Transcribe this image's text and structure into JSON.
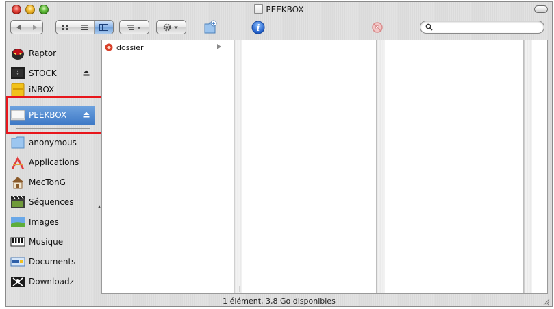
{
  "window": {
    "title": "PEEKBOX"
  },
  "toolbar": {
    "back_icon": "back-arrow-icon",
    "forward_icon": "forward-arrow-icon",
    "view_icons": [
      "icon-view-icon",
      "list-view-icon",
      "column-view-icon"
    ],
    "arrange_icon": "arrange-icon",
    "action_icon": "gear-icon",
    "new_folder_icon": "new-folder-icon",
    "info_icon": "info-icon",
    "burn_icon": "burn-icon",
    "search": {
      "value": "",
      "placeholder": ""
    }
  },
  "sidebar": {
    "items": [
      {
        "label": "Raptor",
        "icon": "raptor-disk-icon",
        "eject": false
      },
      {
        "label": "STOCK",
        "icon": "stock-drive-icon",
        "eject": true
      },
      {
        "label": "iNBOX",
        "icon": "inbox-drive-icon",
        "eject": false
      },
      {
        "label": "PEEKBOX",
        "icon": "peekbox-drive-icon",
        "eject": true,
        "selected": true
      },
      {
        "label": "anonymous",
        "icon": "folder-icon",
        "eject": false
      },
      {
        "label": "Applications",
        "icon": "applications-icon",
        "eject": false
      },
      {
        "label": "MecTonG",
        "icon": "home-icon",
        "eject": false
      },
      {
        "label": "Séquences",
        "icon": "movies-icon",
        "eject": false
      },
      {
        "label": "Images",
        "icon": "pictures-icon",
        "eject": false
      },
      {
        "label": "Musique",
        "icon": "music-icon",
        "eject": false
      },
      {
        "label": "Documents",
        "icon": "documents-icon",
        "eject": false
      },
      {
        "label": "Downloadz",
        "icon": "downloads-icon",
        "eject": false
      }
    ]
  },
  "browser": {
    "columns": [
      {
        "items": [
          {
            "label": "dossier",
            "icon": "dossier-folder-icon",
            "has_children": true
          }
        ]
      },
      {
        "items": []
      },
      {
        "items": []
      }
    ]
  },
  "status": {
    "text": "1 élément, 3,8 Go disponibles"
  },
  "colors": {
    "selection": "#3e79c6",
    "annotation_box": "#e8161c"
  }
}
